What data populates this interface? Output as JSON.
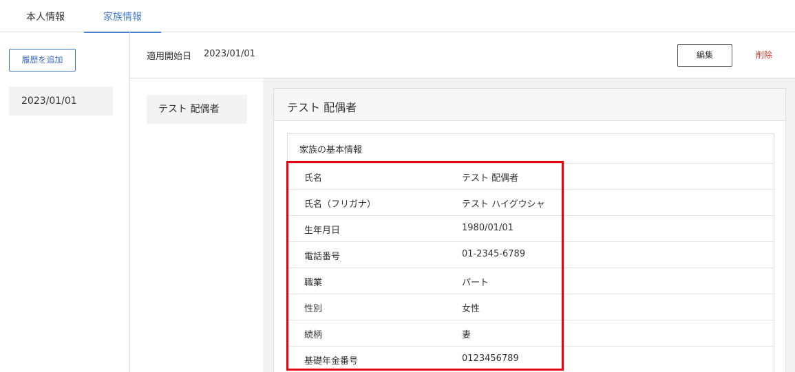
{
  "tabs": [
    {
      "label": "本人情報",
      "active": false
    },
    {
      "label": "家族情報",
      "active": true
    }
  ],
  "sidebar": {
    "add_history_label": "履歴を追加",
    "history_items": [
      "2023/01/01"
    ]
  },
  "header": {
    "start_date_label": "適用開始日",
    "start_date_value": "2023/01/01",
    "edit_label": "編集",
    "delete_label": "削除"
  },
  "members": [
    "テスト 配偶者"
  ],
  "card": {
    "title": "テスト 配偶者",
    "section_title": "家族の基本情報",
    "rows": [
      {
        "label": "氏名",
        "value": "テスト 配偶者"
      },
      {
        "label": "氏名（フリガナ）",
        "value": "テスト ハイグウシャ"
      },
      {
        "label": "生年月日",
        "value": "1980/01/01"
      },
      {
        "label": "電話番号",
        "value": "01-2345-6789"
      },
      {
        "label": "職業",
        "value": "パート"
      },
      {
        "label": "性別",
        "value": "女性"
      },
      {
        "label": "続柄",
        "value": "妻"
      },
      {
        "label": "基礎年金番号",
        "value": "0123456789"
      }
    ]
  },
  "colors": {
    "accent": "#4a7fd0",
    "primary_button": "#3d6fc4",
    "danger": "#d9362d",
    "highlight": "#e60012"
  }
}
